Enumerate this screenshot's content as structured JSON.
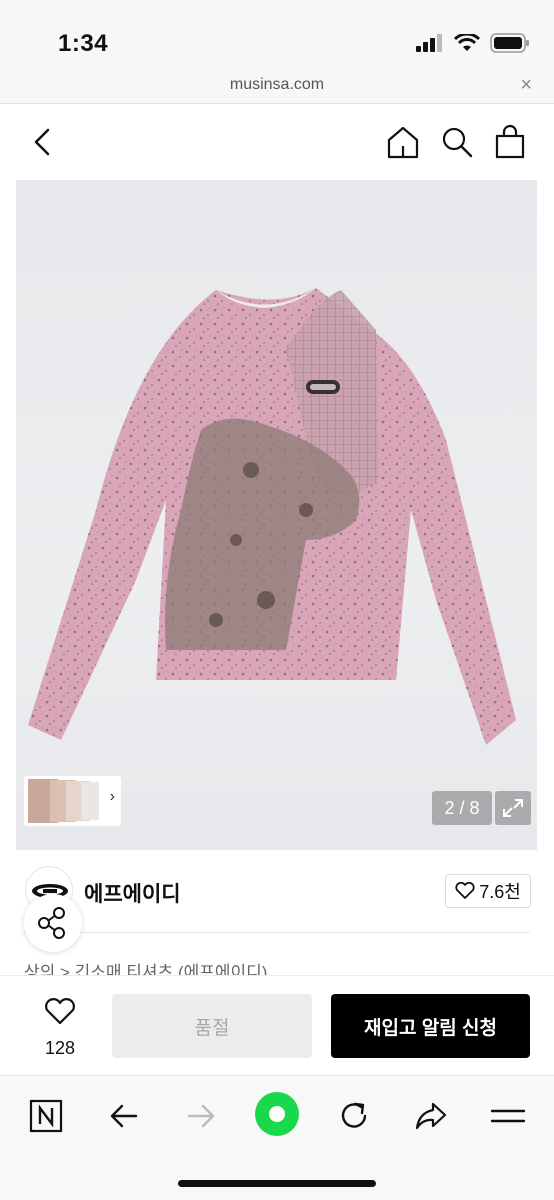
{
  "status_bar": {
    "time": "1:34"
  },
  "url_bar": {
    "domain": "musinsa.com",
    "close_label": "×"
  },
  "image_viewer": {
    "counter": "2 / 8",
    "thumb_chevron": "›"
  },
  "brand": {
    "name": "에프에이디",
    "like_count": "7.6천"
  },
  "breadcrumb": {
    "text": "상의  >  긴소매 티셔츠 (에프에이디)"
  },
  "action_bar": {
    "wish_count": "128",
    "soldout_label": "품절",
    "restock_label": "재입고 알림 신청"
  },
  "colors": {
    "accent_green": "#1ad84b",
    "primary_black": "#000000",
    "disabled_gray": "#ececec"
  },
  "icons": [
    "back-arrow-icon",
    "home-icon",
    "search-icon",
    "shopping-bag-icon",
    "heart-icon",
    "share-icon",
    "expand-icon",
    "naver-icon",
    "arrow-left-icon",
    "arrow-right-icon",
    "green-dot-icon",
    "refresh-icon",
    "forward-share-icon",
    "menu-icon"
  ]
}
